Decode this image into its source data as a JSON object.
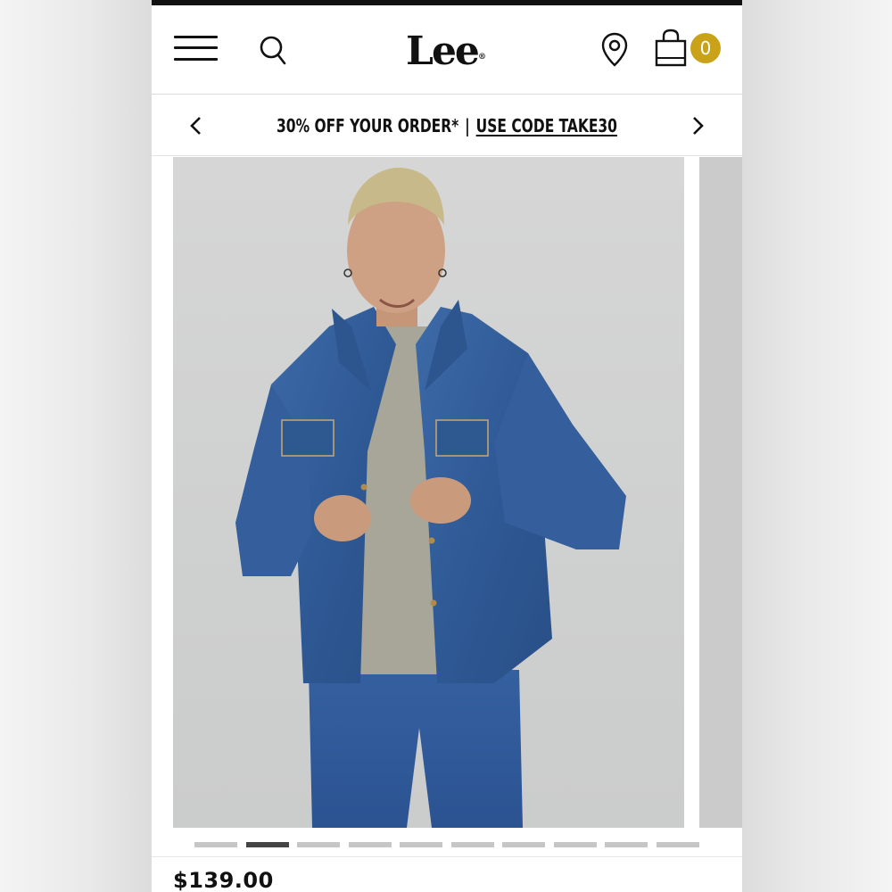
{
  "header": {
    "logo_text": "Lee",
    "logo_mark": "®",
    "cart_count": "0",
    "icons": {
      "menu": "hamburger-menu-icon",
      "search": "search-icon",
      "location": "location-pin-icon",
      "cart": "shopping-bag-icon"
    }
  },
  "promo": {
    "text": "30% OFF YOUR ORDER*",
    "separator": "|",
    "code_link": "USE CODE TAKE30"
  },
  "gallery": {
    "slide_count": 10,
    "active_slide": 2
  },
  "product": {
    "price": "$139.00"
  },
  "colors": {
    "badge": "#c9a219",
    "text": "#111111",
    "active_dot": "#444444",
    "inactive_dot": "#c6c6c6"
  }
}
